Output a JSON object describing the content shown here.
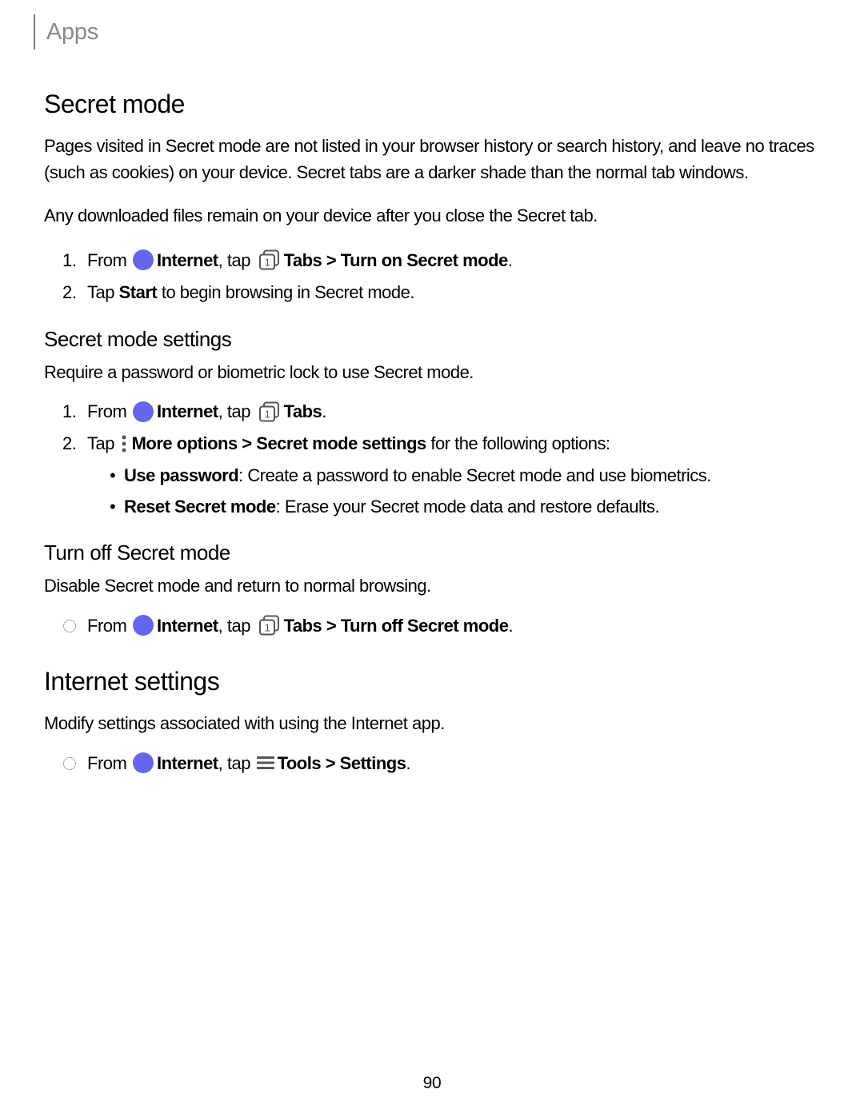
{
  "breadcrumb": "Apps",
  "secret_mode": {
    "heading": "Secret mode",
    "para1": "Pages visited in Secret mode are not listed in your browser history or search history, and leave no traces (such as cookies) on your device. Secret tabs are a darker shade than the normal tab windows.",
    "para2": "Any downloaded files remain on your device after you close the Secret tab.",
    "step1_pre": "From ",
    "step1_internet": "Internet",
    "step1_mid": ", tap ",
    "step1_tabs_action": "Tabs > Turn on Secret mode",
    "step1_end": ".",
    "step2_pre": "Tap ",
    "step2_start": "Start",
    "step2_end": " to begin browsing in Secret mode."
  },
  "settings_sub": {
    "heading": "Secret mode settings",
    "intro": "Require a password or biometric lock to use Secret mode.",
    "s1_pre": "From ",
    "s1_internet": "Internet",
    "s1_mid": ", tap ",
    "s1_tabs": "Tabs",
    "s1_end": ".",
    "s2_pre": "Tap ",
    "s2_more_action": "More options > Secret mode settings",
    "s2_end": " for the following options:",
    "opt1_bold": "Use password",
    "opt1_text": ": Create a password to enable Secret mode and use biometrics.",
    "opt2_bold": "Reset Secret mode",
    "opt2_text": ": Erase your Secret mode data and restore defaults."
  },
  "turnoff_sub": {
    "heading": "Turn off Secret mode",
    "intro": "Disable Secret mode and return to normal browsing.",
    "step_pre": "From ",
    "step_internet": "Internet",
    "step_mid": ", tap ",
    "step_tabs_action": "Tabs > Turn off Secret mode",
    "step_end": "."
  },
  "internet_settings": {
    "heading": "Internet settings",
    "intro": "Modify settings associated with using the Internet app.",
    "step_pre": "From ",
    "step_internet": "Internet",
    "step_mid": ", tap ",
    "step_tools_action": "Tools > Settings",
    "step_end": "."
  },
  "page_number": "90"
}
